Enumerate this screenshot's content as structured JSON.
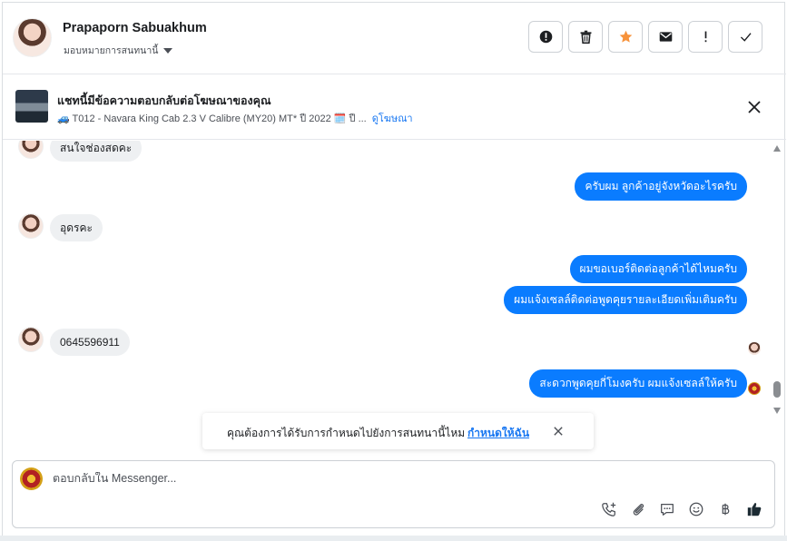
{
  "header": {
    "contact_name": "Prapaporn Sabuakhum",
    "assign_label": "มอบหมายการสนทนานี้",
    "actions": [
      {
        "icon": "alert-circle-icon",
        "name": "mark-spam-button"
      },
      {
        "icon": "trash-icon",
        "name": "delete-button"
      },
      {
        "icon": "star-icon",
        "name": "follow-up-button"
      },
      {
        "icon": "envelope-icon",
        "name": "mark-unread-button"
      },
      {
        "icon": "exclamation-icon",
        "name": "priority-button"
      },
      {
        "icon": "checkmark-icon",
        "name": "mark-done-button"
      }
    ]
  },
  "ad": {
    "title": "แชทนี้มีข้อความตอบกลับต่อโฆษณาของคุณ",
    "subtitle": "🚙 T012 - Navara King Cab 2.3 V Calibre (MY20) MT* ปี 2022 🗓️ ปี ...",
    "link": "ดูโฆษณา"
  },
  "messages": [
    {
      "dir": "in",
      "text": "สนใจช่องสดคะ"
    },
    {
      "dir": "out",
      "text": "ครับผม ลูกค้าอยู่จังหวัดอะไรครับ"
    },
    {
      "dir": "in",
      "text": "อุดรคะ"
    },
    {
      "dir": "out",
      "text": "ผมขอเบอร์ติดต่อลูกค้าได้ไหมครับ"
    },
    {
      "dir": "out",
      "text": "ผมแจ้งเซลล์ติดต่อพูดคุยรายละเอียดเพิ่มเติมครับ"
    },
    {
      "dir": "in",
      "text": "0645596911"
    },
    {
      "dir": "out",
      "text": "สะดวกพูดคุยกี่โมงครับ ผมแจ้งเซลล์ให้ครับ"
    }
  ],
  "toast": {
    "text": "คุณต้องการได้รับการกำหนดไปยังการสนทนานี้ไหม",
    "link": "กำหนดให้ฉัน"
  },
  "composer": {
    "placeholder": "ตอบกลับใน Messenger...",
    "tools": [
      "phone-add-icon",
      "paperclip-icon",
      "chat-bubble-icon",
      "emoji-icon",
      "baht-icon",
      "thumbs-up-icon"
    ]
  },
  "colors": {
    "accent": "#0a7cff",
    "star": "#f7923a",
    "link": "#1877f2"
  }
}
